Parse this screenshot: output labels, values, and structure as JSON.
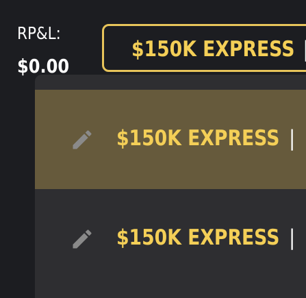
{
  "rpl": {
    "label": "RP&L:",
    "value": "$0.00"
  },
  "account_select": {
    "selected_label": "$150K EXPRESS",
    "separator": "|"
  },
  "dropdown": {
    "options": [
      {
        "label": "$150K EXPRESS",
        "separator": "|",
        "selected": true,
        "icon": "pencil-icon"
      },
      {
        "label": "$150K EXPRESS",
        "separator": "|",
        "selected": false,
        "icon": "pencil-icon"
      }
    ]
  },
  "colors": {
    "background": "#1c1d21",
    "accent_gold": "#f4cf57",
    "border_gold": "#e7c45a",
    "dropdown_bg": "#2e2e31",
    "selected_bg": "#665a3c",
    "icon_gray": "#8a8a8a"
  }
}
